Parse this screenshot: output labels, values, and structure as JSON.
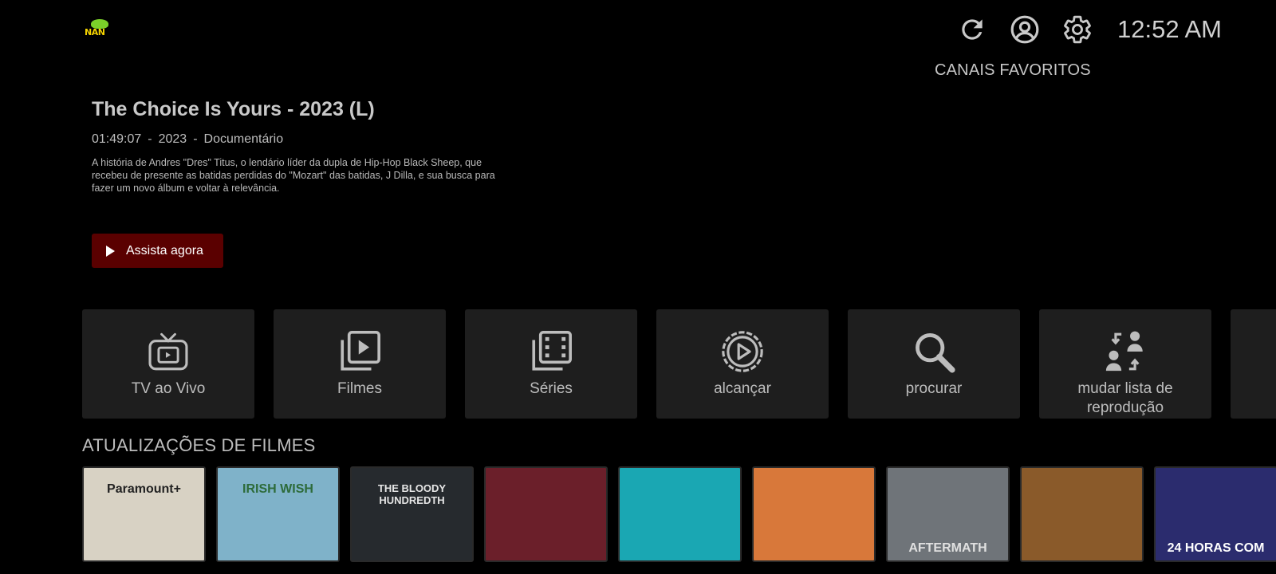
{
  "app": {
    "logo_text": "NAN"
  },
  "header": {
    "clock": "12:52 AM",
    "favorites_label": "CANAIS FAVORITOS",
    "icons": [
      "refresh-icon",
      "account-icon",
      "gear-icon"
    ]
  },
  "featured": {
    "title": "The Choice Is Yours - 2023 (L)",
    "duration": "01:49:07",
    "year": "2023",
    "genre": "Documentário",
    "separator": "-",
    "description": "A história de Andres \"Dres\" Titus, o lendário líder da dupla de Hip-Hop Black Sheep, que recebeu de presente as batidas perdidas do \"Mozart\" das batidas, J Dilla, e sua busca para fazer um novo álbum e voltar à relevância.",
    "watch_label": "Assista agora"
  },
  "tiles": [
    {
      "label": "TV ao Vivo",
      "icon": "tv-icon"
    },
    {
      "label": "Filmes",
      "icon": "movies-icon"
    },
    {
      "label": "Séries",
      "icon": "series-icon"
    },
    {
      "label": "alcançar",
      "icon": "catchup-icon"
    },
    {
      "label": "procurar",
      "icon": "search-icon"
    },
    {
      "label": "mudar lista de reprodução",
      "icon": "switch-users-icon"
    }
  ],
  "movies_section": {
    "title": "ATUALIZAÇÕES DE FILMES",
    "posters": [
      {
        "text": "Paramount+",
        "bg": "#d8d2c4",
        "fg": "#222"
      },
      {
        "text": "IRISH WISH",
        "bg": "#7fb2c9",
        "fg": "#2d6b3a"
      },
      {
        "text": "THE BLOODY HUNDREDTH",
        "bg": "#262a2e",
        "fg": "#e6e6e6"
      },
      {
        "text": "",
        "bg": "#6b1f2a",
        "fg": "#fff"
      },
      {
        "text": "",
        "bg": "#1aa7b3",
        "fg": "#fff"
      },
      {
        "text": "",
        "bg": "#d8783a",
        "fg": "#fff"
      },
      {
        "text": "AFTERMATH",
        "bg": "#6f7479",
        "fg": "#e0e0e0"
      },
      {
        "text": "",
        "bg": "#8a5a2a",
        "fg": "#fff"
      },
      {
        "text": "24 HORAS COM",
        "bg": "#2b2c6e",
        "fg": "#fff"
      }
    ]
  },
  "colors": {
    "accent": "#5a0000",
    "tile_bg": "#1e1e1e"
  }
}
